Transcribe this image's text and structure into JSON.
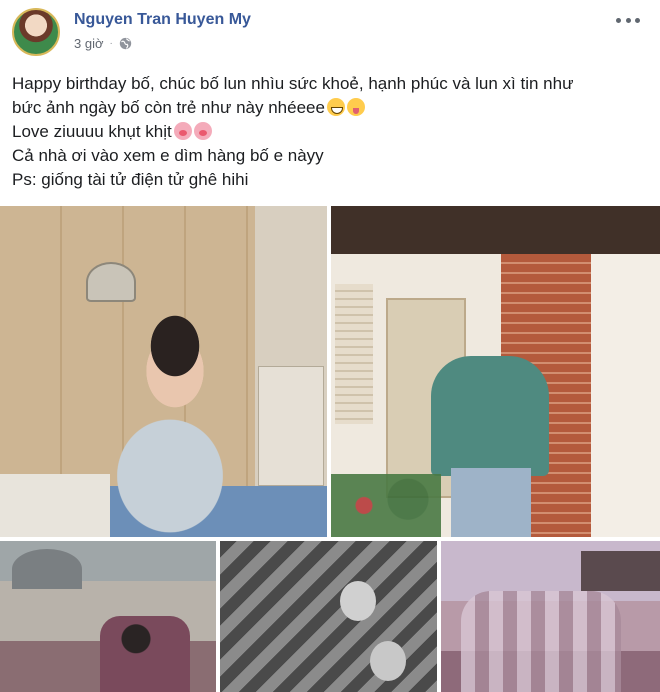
{
  "post": {
    "author": "Nguyen Tran Huyen My",
    "time": "3 giờ",
    "lines": [
      "Happy birthday bố, chúc bố lun nhìu sức khoẻ, hạnh phúc và lun xì tin như",
      "bức ảnh ngày bố còn trẻ như này nhéeee",
      "Love ziuuuu khụt khịt",
      "Cả nhà ơi vào xem e dìm hàng bố e nàyy",
      "Ps: giống tài tử điện tử ghê hihi"
    ],
    "emojis": {
      "line2": [
        "grinning-face-emoji",
        "squinting-tongue-emoji"
      ],
      "line3": [
        "pig-nose-emoji",
        "pig-nose-emoji"
      ]
    }
  },
  "colors": {
    "author": "#385898",
    "meta": "#616770",
    "text": "#1c1e21"
  }
}
